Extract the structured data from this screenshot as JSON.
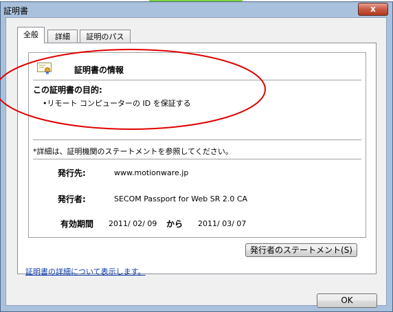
{
  "window": {
    "title": "証明書",
    "close_label": "x"
  },
  "tabs": [
    {
      "label": "全般",
      "active": true
    },
    {
      "label": "詳細",
      "active": false
    },
    {
      "label": "証明のパス",
      "active": false
    }
  ],
  "info": {
    "heading": "証明書の情報",
    "purpose_title": "この証明書の目的:",
    "purpose_item": "•リモート コンピューターの ID を保証する",
    "note": "*詳細は、証明機関のステートメントを参照してください。"
  },
  "fields": {
    "issued_to_label": "発行先:",
    "issued_to_value": "www.motionware.jp",
    "issued_by_label": "発行者:",
    "issued_by_value": "SECOM Passport for Web SR 2.0 CA",
    "validity_label": "有効期間",
    "valid_from": "2011/ 02/ 09",
    "valid_to_word": "から",
    "valid_to": "2011/ 03/ 07"
  },
  "buttons": {
    "issuer_statement": "発行者のステートメント(S)",
    "ok": "OK"
  },
  "link": {
    "details": "証明書の詳細について表示します。"
  },
  "colors": {
    "annotation_oval": "#e00000",
    "accent_blob": "#7fd63a",
    "frame": "#a9c1dc"
  }
}
